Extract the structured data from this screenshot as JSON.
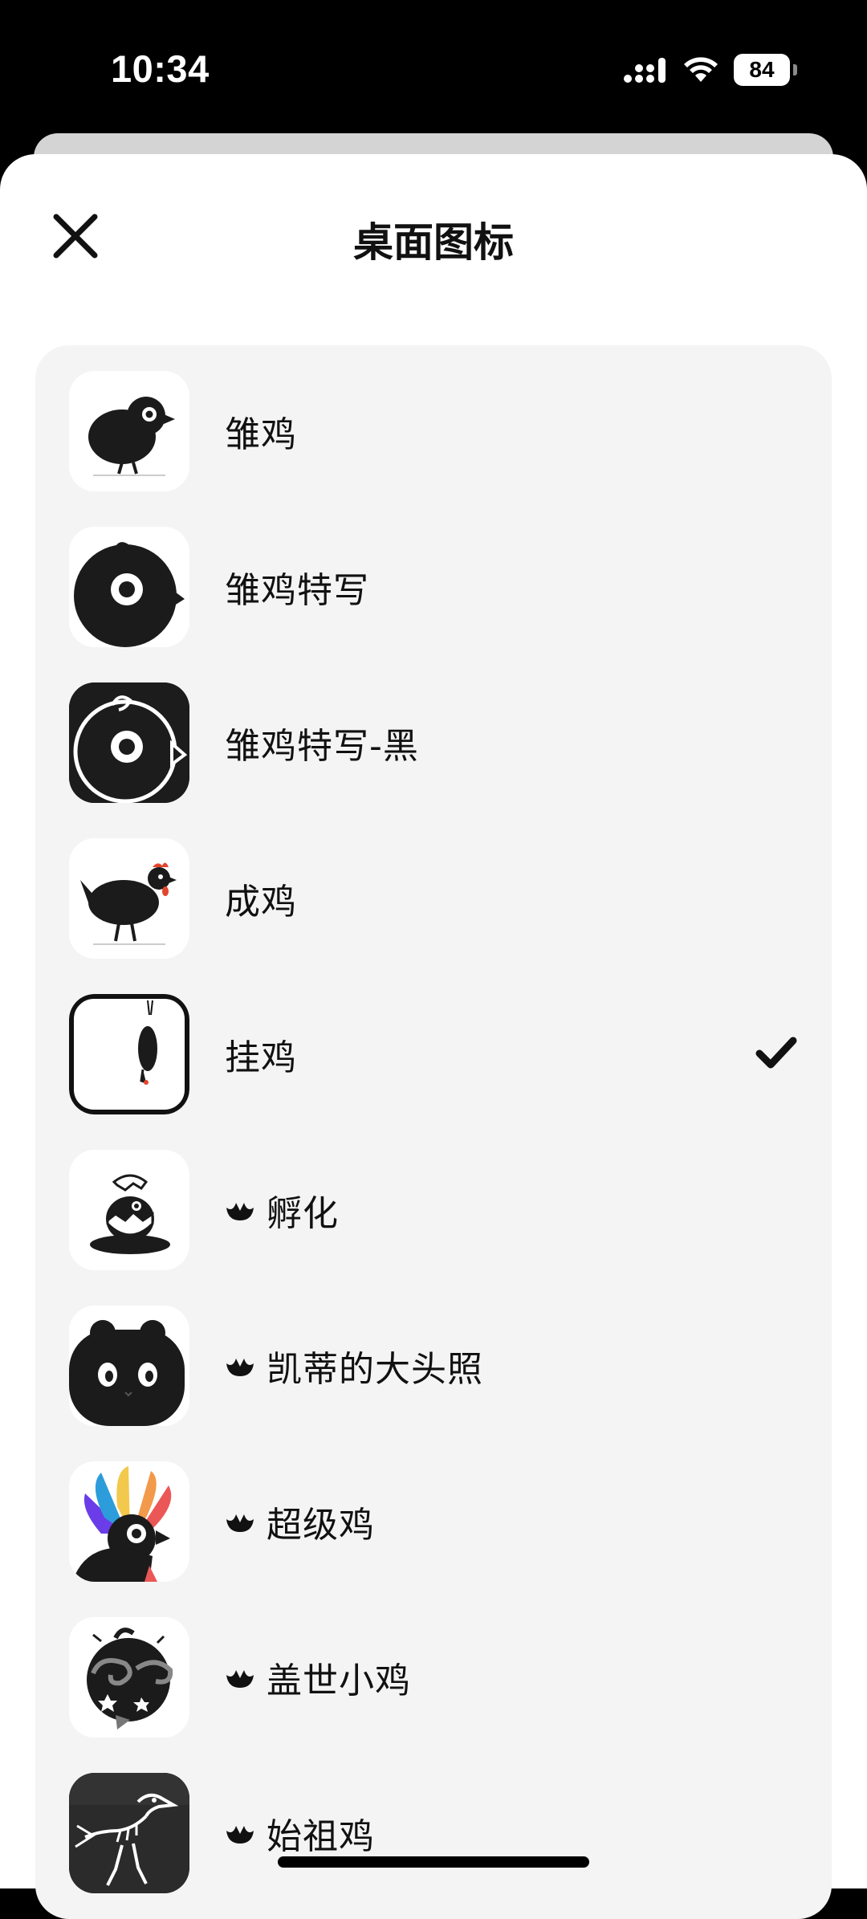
{
  "status_bar": {
    "time": "10:34",
    "battery": "84",
    "icons": [
      "signal-icon",
      "wifi-icon",
      "battery-icon"
    ]
  },
  "header": {
    "title": "桌面图标",
    "close_icon": "close-icon"
  },
  "icons": [
    {
      "label": "雏鸡",
      "premium": false,
      "selected": false,
      "art": "chick"
    },
    {
      "label": "雏鸡特写",
      "premium": false,
      "selected": false,
      "art": "chick-closeup"
    },
    {
      "label": "雏鸡特写-黑",
      "premium": false,
      "selected": false,
      "art": "chick-closeup-dark"
    },
    {
      "label": "成鸡",
      "premium": false,
      "selected": false,
      "art": "hen"
    },
    {
      "label": "挂鸡",
      "premium": false,
      "selected": true,
      "art": "hanging-chicken"
    },
    {
      "label": "孵化",
      "premium": true,
      "selected": false,
      "art": "hatching"
    },
    {
      "label": "凯蒂的大头照",
      "premium": true,
      "selected": false,
      "art": "bear-head"
    },
    {
      "label": "超级鸡",
      "premium": true,
      "selected": false,
      "art": "super-chicken"
    },
    {
      "label": "盖世小鸡",
      "premium": true,
      "selected": false,
      "art": "dizzy-chick"
    },
    {
      "label": "始祖鸡",
      "premium": true,
      "selected": false,
      "art": "fossil-bird"
    }
  ],
  "colors": {
    "background": "#000000",
    "sheet": "#ffffff",
    "card": "#f4f4f4",
    "text": "#111111",
    "accent_red": "#e2452c"
  }
}
